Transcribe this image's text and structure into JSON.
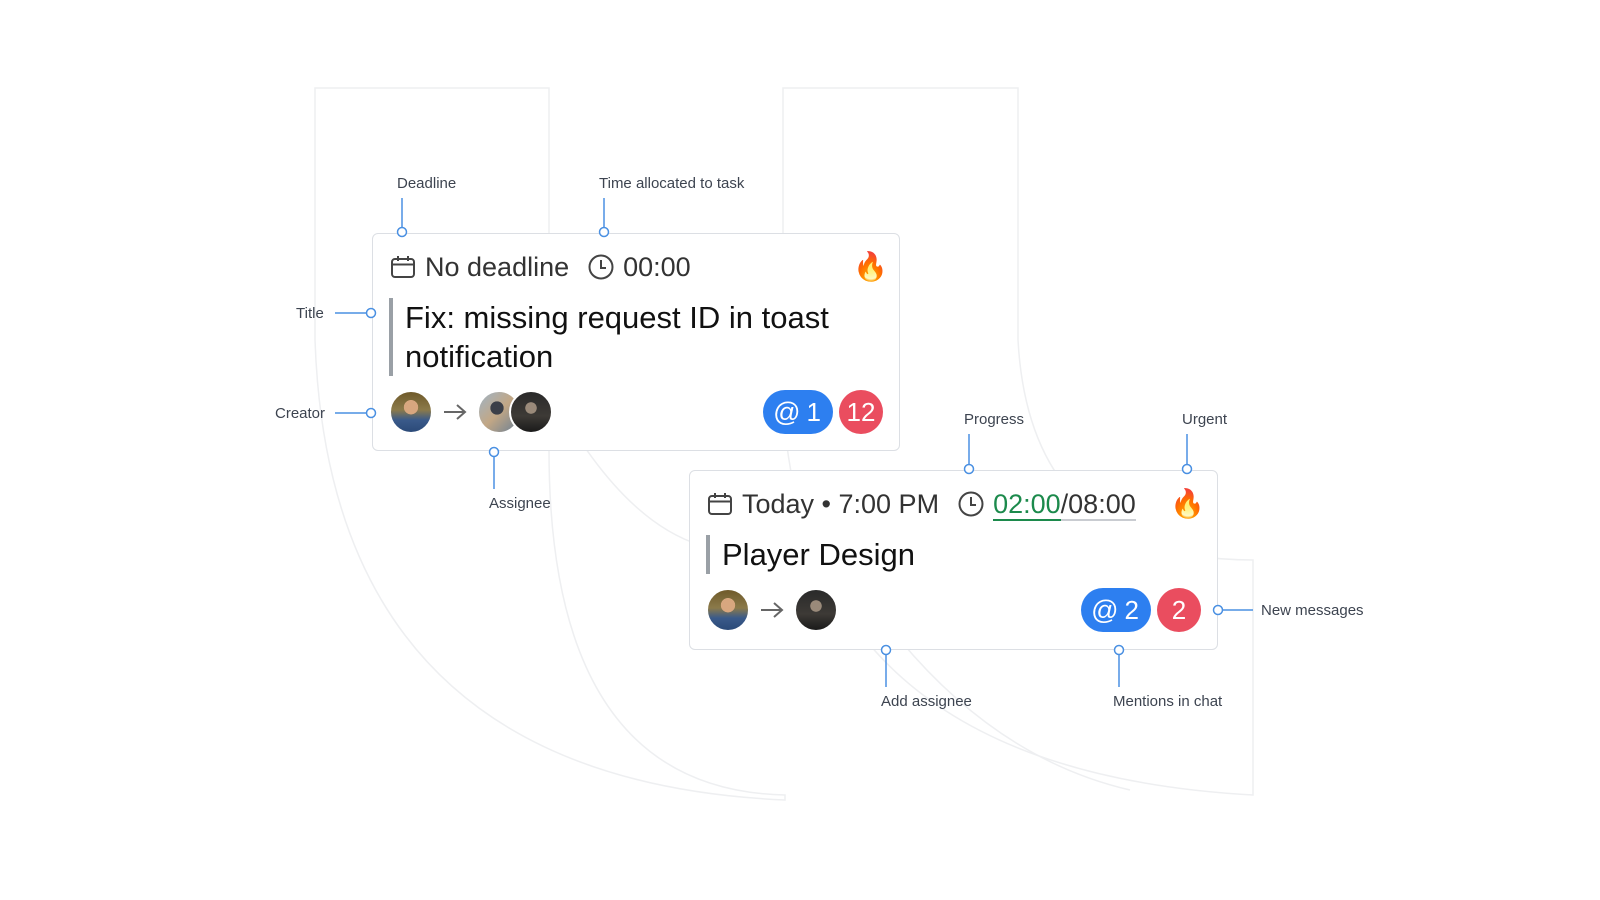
{
  "annotations": {
    "deadline": "Deadline",
    "time_allocated": "Time allocated to task",
    "title": "Title",
    "creator": "Creator",
    "assignee": "Assignee",
    "progress": "Progress",
    "urgent": "Urgent",
    "new_messages": "New messages",
    "add_assignee": "Add assignee",
    "mentions_in_chat": "Mentions in chat"
  },
  "card1": {
    "deadline": "No deadline",
    "time": "00:00",
    "urgent_icon": "fire-icon",
    "title_line1": "Fix: missing request ID in toast",
    "title_line2": "notification",
    "mentions": "1",
    "messages": "12"
  },
  "card2": {
    "deadline": "Today • 7:00 PM",
    "progress_done": "02:00",
    "progress_sep": "/",
    "progress_total": "08:00",
    "progress_fraction": 0.25,
    "urgent_icon": "fire-icon",
    "title": "Player Design",
    "mentions": "2",
    "messages": "2"
  },
  "colors": {
    "accent": "#2d7ff0",
    "message_badge": "#ea4d5f",
    "progress": "#1c8a4c",
    "annotation_line": "#4a90e2"
  }
}
